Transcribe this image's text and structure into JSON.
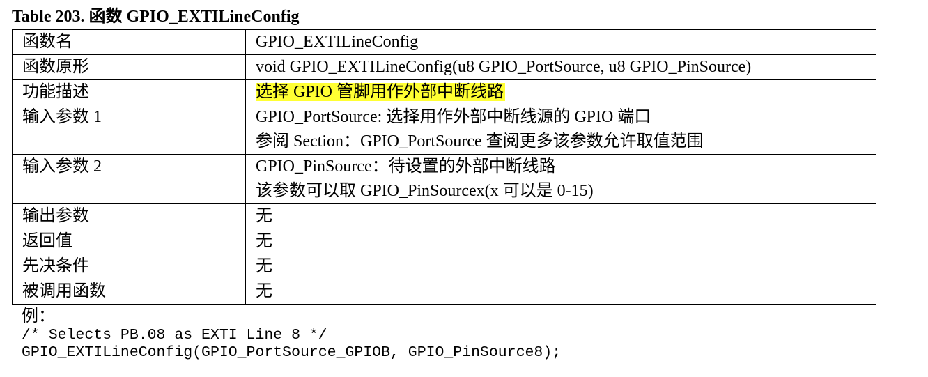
{
  "title": "Table 203.  函数 GPIO_EXTILineConfig",
  "rows": [
    {
      "name": "函数名",
      "lines": [
        "GPIO_EXTILineConfig"
      ]
    },
    {
      "name": "函数原形",
      "lines": [
        "void GPIO_EXTILineConfig(u8 GPIO_PortSource, u8 GPIO_PinSource)"
      ]
    },
    {
      "name": "功能描述",
      "lines": [
        "选择 GPIO 管脚用作外部中断线路"
      ],
      "highlight": true,
      "highlight_color": "#ffff33"
    },
    {
      "name": "输入参数 1",
      "lines": [
        "GPIO_PortSource: 选择用作外部中断线源的 GPIO 端口",
        "参阅 Section：GPIO_PortSource 查阅更多该参数允许取值范围"
      ]
    },
    {
      "name": "输入参数 2",
      "lines": [
        "GPIO_PinSource：待设置的外部中断线路",
        "该参数可以取 GPIO_PinSourcex(x 可以是 0-15)"
      ]
    },
    {
      "name": "输出参数",
      "lines": [
        "无"
      ]
    },
    {
      "name": "返回值",
      "lines": [
        "无"
      ]
    },
    {
      "name": "先决条件",
      "lines": [
        "无"
      ]
    },
    {
      "name": "被调用函数",
      "lines": [
        "无"
      ]
    }
  ],
  "example": {
    "label": "例：",
    "code": [
      "/* Selects PB.08 as EXTI Line 8 */",
      "GPIO_EXTILineConfig(GPIO_PortSource_GPIOB, GPIO_PinSource8);"
    ]
  }
}
